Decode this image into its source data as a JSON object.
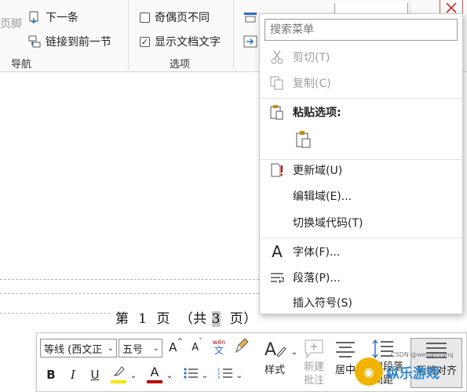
{
  "ribbon": {
    "navigation": {
      "header_footer_partial": "页脚",
      "next_label": "下一条",
      "link_prev_label": "链接到前一节",
      "group_label": "导航"
    },
    "options": {
      "odd_even_label": "奇偶页不同",
      "odd_even_checked": false,
      "show_doc_text_label": "显示文档文字",
      "show_doc_text_checked": true,
      "check_mark": "✓",
      "group_label": "选项"
    }
  },
  "document": {
    "footer": {
      "prefix": "第  1  页  （共 ",
      "total_pages_field": "3",
      "suffix": "  页）"
    }
  },
  "context_menu": {
    "search_placeholder": "搜索菜单",
    "items": [
      {
        "label": "剪切(T)",
        "icon": "scissors-icon",
        "disabled": true
      },
      {
        "label": "复制(C)",
        "icon": "copy-icon",
        "disabled": true
      },
      {
        "label": "粘贴选项:",
        "icon": "paste-icon",
        "disabled": false,
        "bold": true
      },
      {
        "label": "更新域(U)",
        "icon": "update-field-icon",
        "disabled": false
      },
      {
        "label": "编辑域(E)...",
        "icon": "",
        "disabled": false
      },
      {
        "label": "切换域代码(T)",
        "icon": "",
        "disabled": false
      },
      {
        "label": "字体(F)...",
        "icon": "font-icon",
        "disabled": false
      },
      {
        "label": "段落(P)...",
        "icon": "paragraph-icon",
        "disabled": false
      },
      {
        "label": "插入符号(S)",
        "icon": "",
        "disabled": false
      }
    ]
  },
  "mini_toolbar": {
    "font_name": "等线 (西文正",
    "font_size": "五号",
    "grow_font": "A",
    "shrink_font": "A",
    "phonetic_top": "wén",
    "phonetic_bottom": "文",
    "bold": "B",
    "italic": "I",
    "underline": "U",
    "highlight_color": "#f5e400",
    "font_color": "#c00000",
    "styles_label": "样式",
    "new_comment_label_1": "新建",
    "new_comment_label_2": "批注",
    "center_label": "居中",
    "line_spacing_label_1": "行和段落",
    "line_spacing_label_2": "间距",
    "justify_label": "两端对齐"
  },
  "watermark": {
    "text": "纵乐游戏",
    "sub": "CSDN @wedanyang"
  }
}
